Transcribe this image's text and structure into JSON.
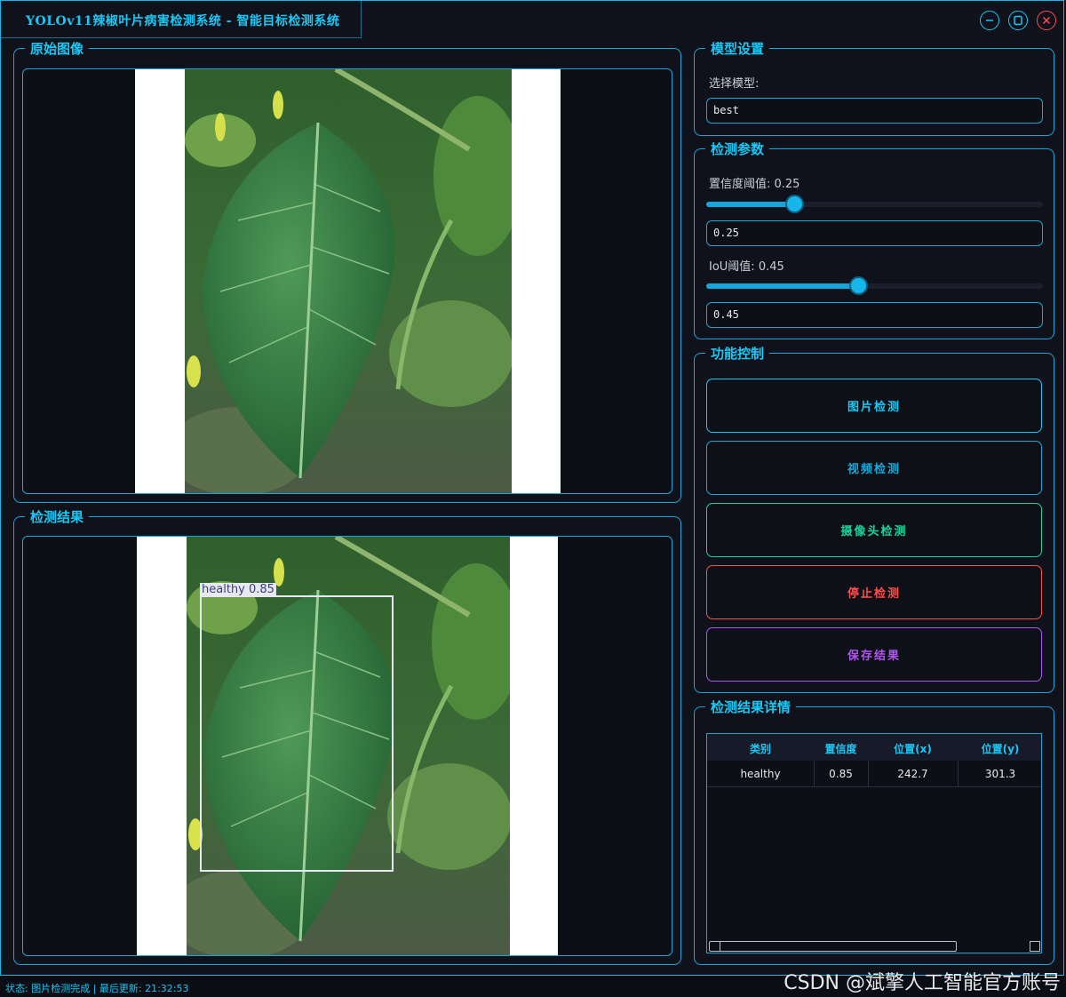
{
  "window": {
    "title": "YOLOv11辣椒叶片病害检测系统 - 智能目标检测系统"
  },
  "original_panel": {
    "title": "原始图像"
  },
  "result_panel": {
    "title": "检测结果",
    "detection_label": "healthy 0.85"
  },
  "model_settings": {
    "title": "模型设置",
    "select_label": "选择模型:",
    "selected_model": "best"
  },
  "detect_params": {
    "title": "检测参数",
    "conf_label": "置信度阈值: 0.25",
    "conf_value": "0.25",
    "conf_fraction": 0.26,
    "iou_label": "IoU阈值: 0.45",
    "iou_value": "0.45",
    "iou_fraction": 0.45
  },
  "functions": {
    "title": "功能控制",
    "buttons": [
      {
        "label": "图片检测",
        "color": "#19c8f5"
      },
      {
        "label": "视频检测",
        "color": "#19a9d6"
      },
      {
        "label": "摄像头检测",
        "color": "#19d39c"
      },
      {
        "label": "停止检测",
        "color": "#ff4d4d"
      },
      {
        "label": "保存结果",
        "color": "#b154f0"
      }
    ]
  },
  "results_table": {
    "title": "检测结果详情",
    "headers": [
      "类别",
      "置信度",
      "位置(x)",
      "位置(y)"
    ],
    "rows": [
      [
        "healthy",
        "0.85",
        "242.7",
        "301.3"
      ]
    ]
  },
  "status_bar": {
    "text": "状态: 图片检测完成 | 最后更新: 21:32:53"
  },
  "watermark": "CSDN @斌擎人工智能官方账号"
}
